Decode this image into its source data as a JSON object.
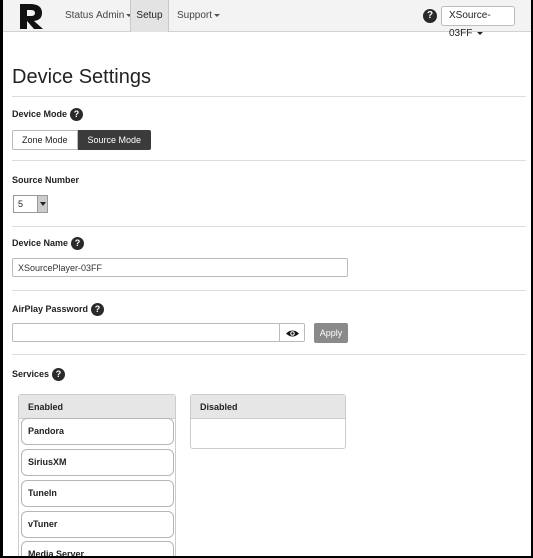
{
  "navbar": {
    "status": "Status",
    "admin": "Admin",
    "setup": "Setup",
    "support": "Support",
    "help": "?",
    "device_button": "XSource-03FF"
  },
  "page": {
    "title": "Device Settings"
  },
  "device_mode": {
    "label": "Device Mode",
    "options": [
      "Zone Mode",
      "Source Mode"
    ],
    "selected": "Source Mode"
  },
  "source_number": {
    "label": "Source Number",
    "value": "5"
  },
  "device_name": {
    "label": "Device Name",
    "value": "XSourcePlayer-03FF"
  },
  "airplay": {
    "label": "AirPlay Password",
    "value": "",
    "apply": "Apply"
  },
  "services": {
    "label": "Services",
    "enabled_header": "Enabled",
    "disabled_header": "Disabled",
    "enabled": [
      "Pandora",
      "SiriusXM",
      "TuneIn",
      "vTuner",
      "Media Server"
    ]
  }
}
